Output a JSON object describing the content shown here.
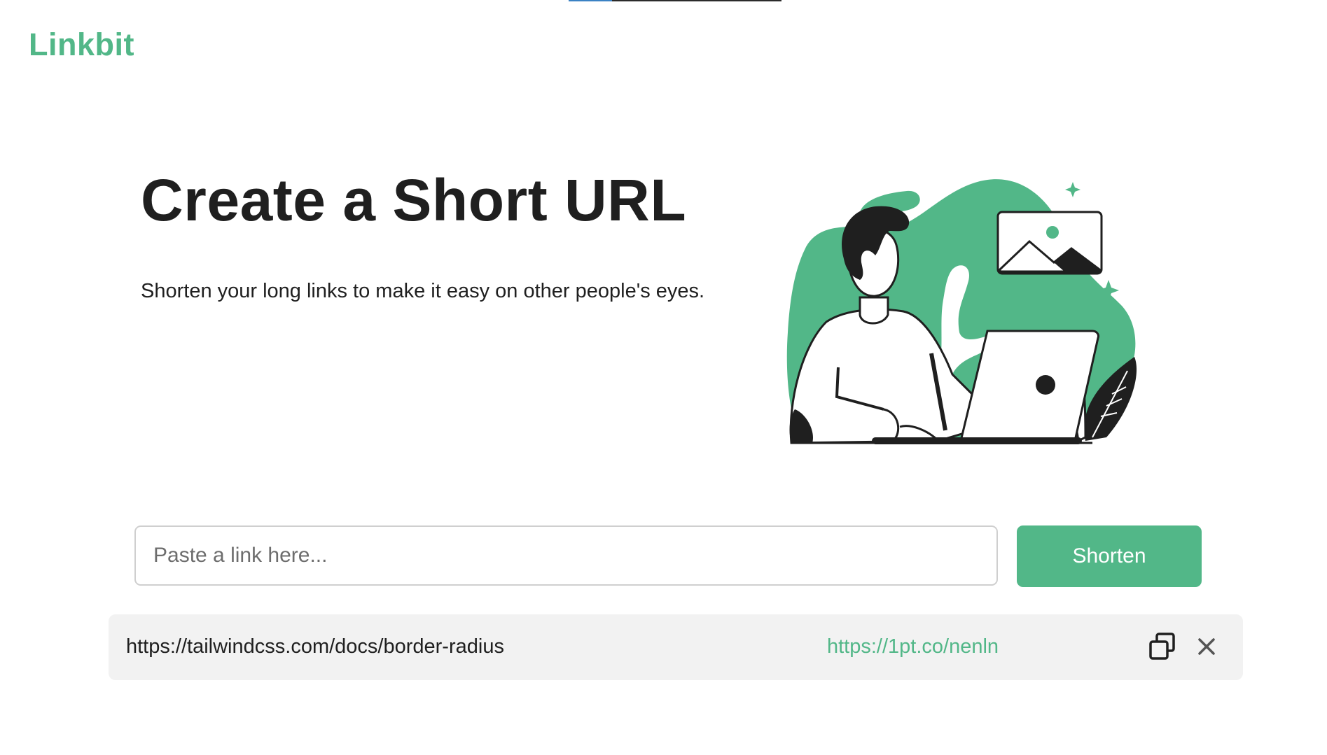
{
  "brand": {
    "logo": "Linkbit",
    "accent_color": "#52b788"
  },
  "hero": {
    "title": "Create a Short URL",
    "subtitle": "Shorten your long links to make it easy on other people's eyes."
  },
  "illustration": {
    "icon": "person-at-laptop-illustration"
  },
  "form": {
    "input_value": "",
    "input_placeholder": "Paste a link here...",
    "button_label": "Shorten"
  },
  "results": [
    {
      "long_url": "https://tailwindcss.com/docs/border-radius",
      "short_url": "https://1pt.co/nenln",
      "copy_icon": "copy-icon",
      "remove_icon": "close-icon"
    }
  ]
}
